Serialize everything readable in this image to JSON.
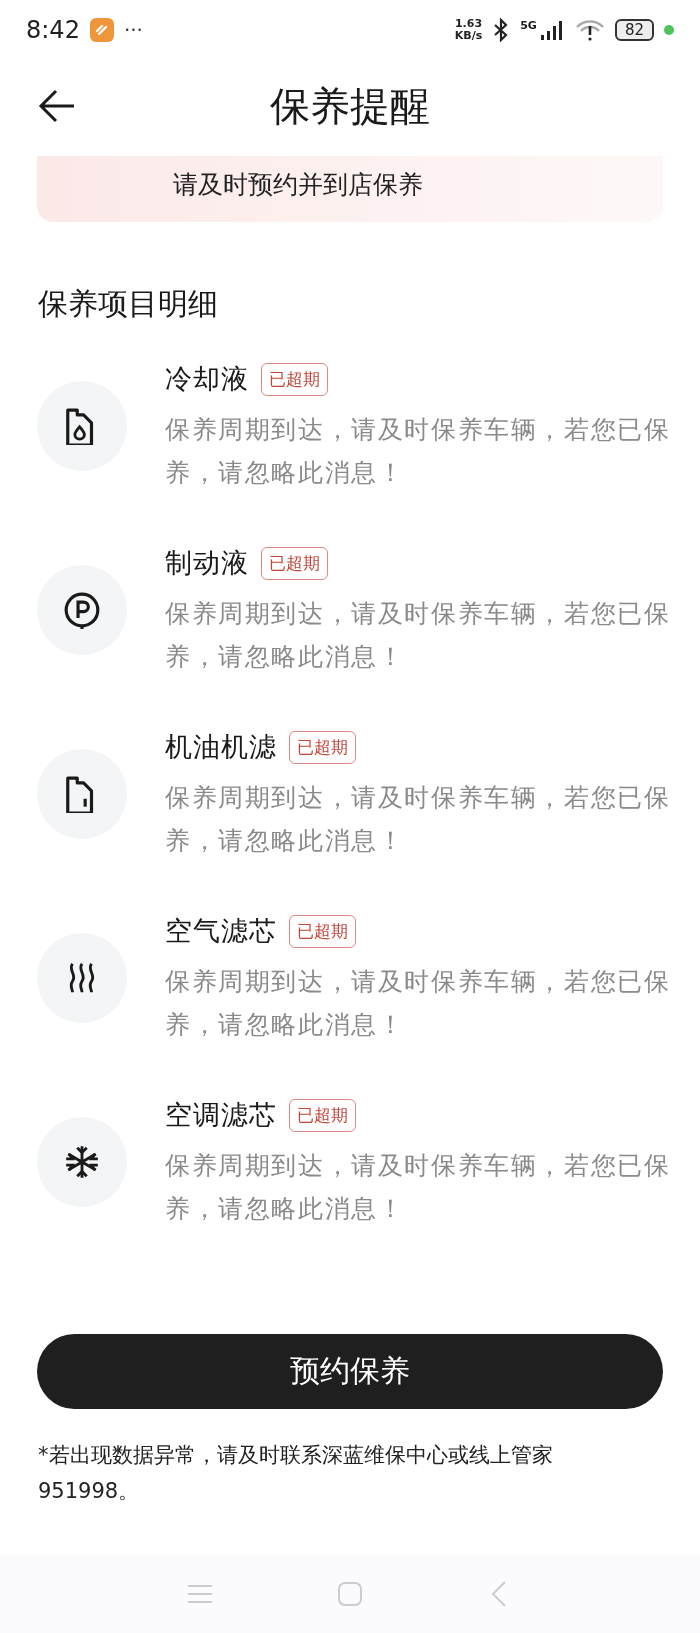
{
  "status_bar": {
    "time": "8:42",
    "more": "···",
    "speed_value": "1.63",
    "speed_unit": "KB/s",
    "network_type": "5G",
    "battery": "82"
  },
  "header": {
    "title": "保养提醒"
  },
  "notice": {
    "text": "请及时预约并到店保养"
  },
  "section_title": "保养项目明细",
  "items": [
    {
      "name": "冷却液",
      "badge": "已超期",
      "description": "保养周期到达，请及时保养车辆，若您已保养，请忽略此消息！"
    },
    {
      "name": "制动液",
      "badge": "已超期",
      "description": "保养周期到达，请及时保养车辆，若您已保养，请忽略此消息！"
    },
    {
      "name": "机油机滤",
      "badge": "已超期",
      "description": "保养周期到达，请及时保养车辆，若您已保养，请忽略此消息！"
    },
    {
      "name": "空气滤芯",
      "badge": "已超期",
      "description": "保养周期到达，请及时保养车辆，若您已保养，请忽略此消息！"
    },
    {
      "name": "空调滤芯",
      "badge": "已超期",
      "description": "保养周期到达，请及时保养车辆，若您已保养，请忽略此消息！"
    }
  ],
  "primary_button": "预约保养",
  "footnote": "*若出现数据异常，请及时联系深蓝维保中心或线上管家951998。"
}
